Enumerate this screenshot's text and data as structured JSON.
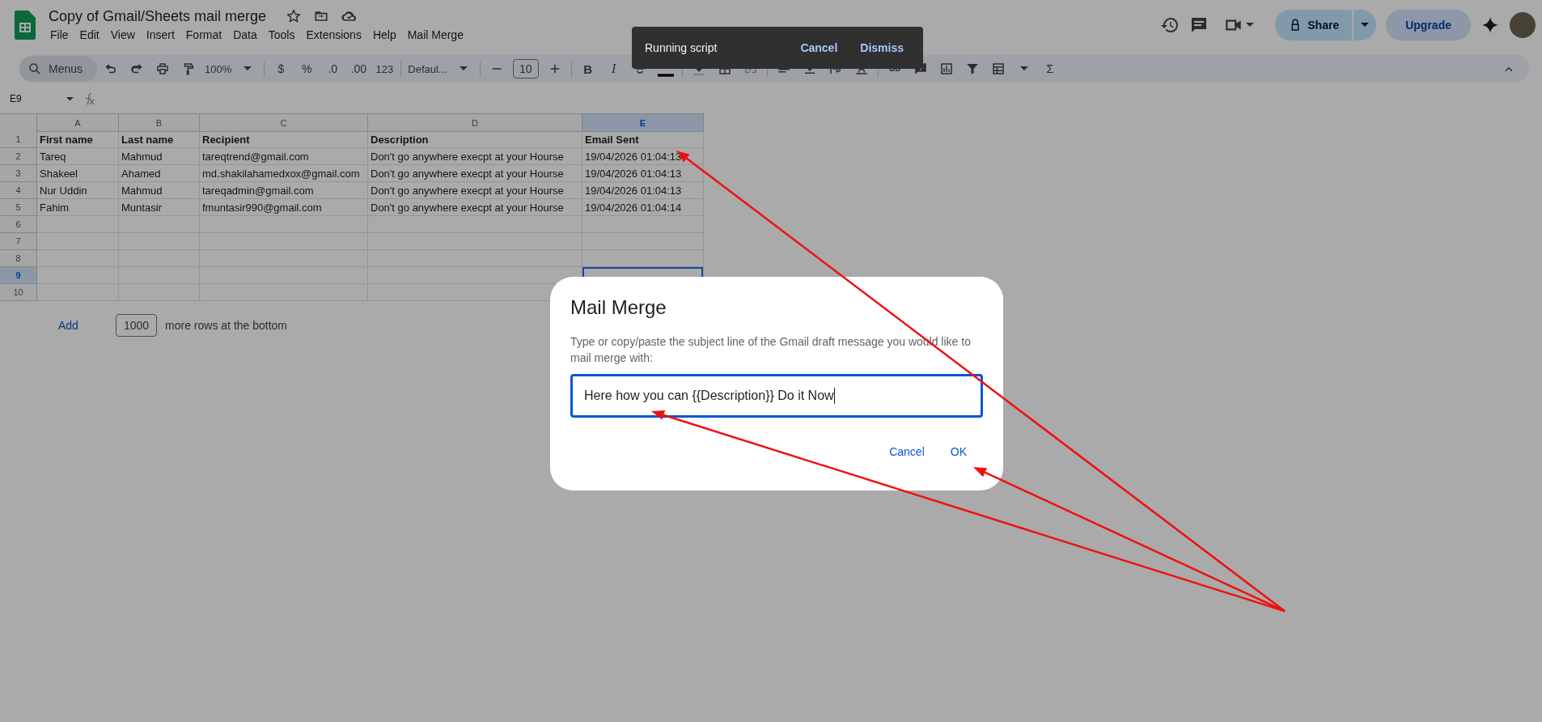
{
  "document": {
    "title": "Copy of Gmail/Sheets mail merge",
    "menus": [
      "File",
      "Edit",
      "View",
      "Insert",
      "Format",
      "Data",
      "Tools",
      "Extensions",
      "Help",
      "Mail Merge"
    ]
  },
  "header_actions": {
    "share": "Share",
    "upgrade": "Upgrade"
  },
  "toolbar": {
    "search": "Menus",
    "zoom": "100%",
    "currency": "$",
    "percent": "%",
    "decrease_decimals": ".0",
    "increase_decimals": ".00",
    "number_format": "123",
    "font": "Defaul...",
    "font_size": "10",
    "bold": "B",
    "italic": "I",
    "functions": "Σ"
  },
  "formula_bar": {
    "cell_reference": "E9"
  },
  "sheet": {
    "columns": [
      {
        "label": "A",
        "selected": false
      },
      {
        "label": "B",
        "selected": false
      },
      {
        "label": "C",
        "selected": false
      },
      {
        "label": "D",
        "selected": false
      },
      {
        "label": "E",
        "selected": true
      }
    ],
    "rows": [
      {
        "label": "1",
        "selected": false,
        "kind": "header",
        "cells": [
          "First name",
          "Last name",
          "Recipient",
          "Description",
          "Email Sent"
        ]
      },
      {
        "label": "2",
        "selected": false,
        "kind": "data",
        "cells": [
          "Tareq",
          "Mahmud",
          "tareqtrend@gmail.com",
          "Don't go anywhere execpt at your Hourse",
          "19/04/2026 01:04:13"
        ]
      },
      {
        "label": "3",
        "selected": false,
        "kind": "data",
        "cells": [
          "Shakeel",
          "Ahamed",
          "md.shakilahamedxox@gmail.com",
          "Don't go anywhere execpt at your Hourse",
          "19/04/2026 01:04:13"
        ]
      },
      {
        "label": "4",
        "selected": false,
        "kind": "data",
        "cells": [
          "Nur Uddin",
          "Mahmud",
          "tareqadmin@gmail.com",
          "Don't go anywhere execpt at your Hourse",
          "19/04/2026 01:04:13"
        ]
      },
      {
        "label": "5",
        "selected": false,
        "kind": "data",
        "cells": [
          "Fahim",
          "Muntasir",
          "fmuntasir990@gmail.com",
          "Don't go anywhere execpt at your Hourse",
          "19/04/2026 01:04:14"
        ]
      },
      {
        "label": "6",
        "selected": false,
        "kind": "data"
      },
      {
        "label": "7",
        "selected": false,
        "kind": "data"
      },
      {
        "label": "8",
        "selected": false,
        "kind": "data"
      },
      {
        "label": "9",
        "selected": true,
        "kind": "data"
      },
      {
        "label": "10",
        "selected": false,
        "kind": "data"
      }
    ]
  },
  "add_rows": {
    "button": "Add",
    "count": "1000",
    "suffix": "more rows at the bottom"
  },
  "toast": {
    "message": "Running script",
    "actions": [
      "Cancel",
      "Dismiss"
    ]
  },
  "dialog": {
    "title": "Mail Merge",
    "description": "Type or copy/paste the subject line of the Gmail draft message you would like to mail merge with:",
    "value": "Here how you can {{Description}} Do it Now",
    "buttons": [
      "Cancel",
      "OK"
    ]
  }
}
